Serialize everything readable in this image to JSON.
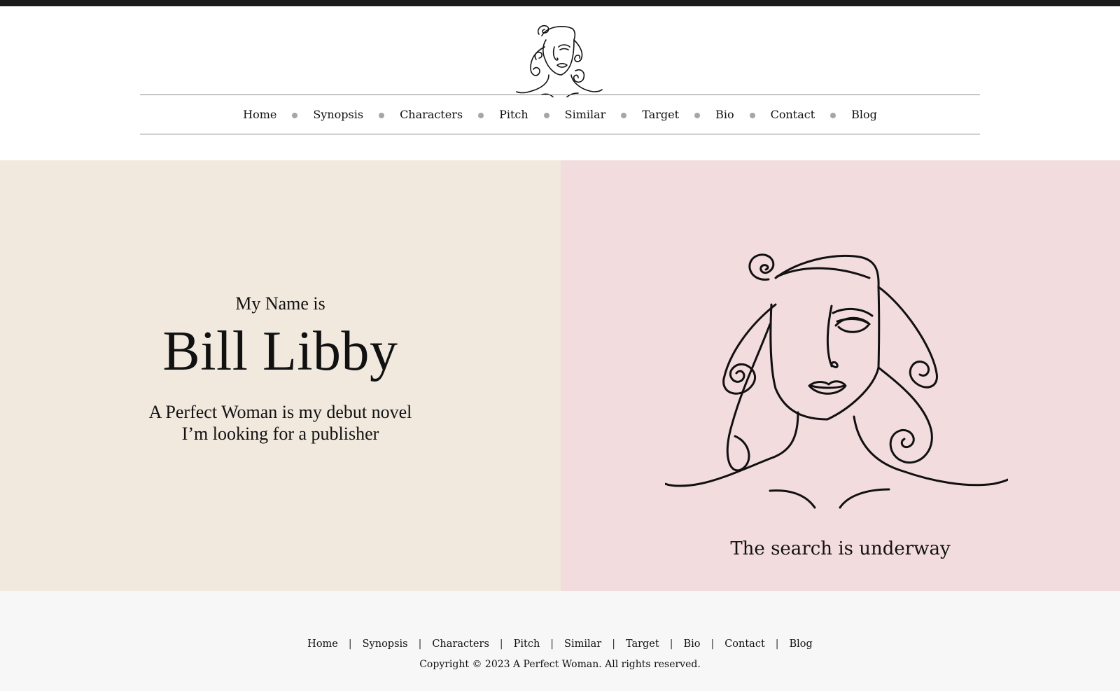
{
  "header": {
    "logo_icon": "line-art-woman-face-icon",
    "nav": [
      {
        "label": "Home"
      },
      {
        "label": "Synopsis"
      },
      {
        "label": "Characters"
      },
      {
        "label": "Pitch"
      },
      {
        "label": "Similar"
      },
      {
        "label": "Target"
      },
      {
        "label": "Bio"
      },
      {
        "label": "Contact"
      },
      {
        "label": "Blog"
      }
    ]
  },
  "hero": {
    "intro": "My Name is",
    "name": "Bill Libby",
    "line1": "A Perfect Woman is my debut novel",
    "line2": "I’m looking for a publisher",
    "portrait_icon": "line-art-woman-portrait",
    "caption": "The search is underway"
  },
  "footer": {
    "links": [
      {
        "label": "Home"
      },
      {
        "label": "Synopsis"
      },
      {
        "label": "Characters"
      },
      {
        "label": "Pitch"
      },
      {
        "label": "Similar"
      },
      {
        "label": "Target"
      },
      {
        "label": "Bio"
      },
      {
        "label": "Contact"
      },
      {
        "label": "Blog"
      }
    ],
    "separator": "|",
    "copyright": "Copyright © 2023 A Perfect Woman. All rights reserved."
  },
  "colors": {
    "top_bar": "#1b1b1b",
    "hero_left_bg": "#f1e9de",
    "hero_right_bg": "#f3dcde",
    "footer_bg": "#f7f7f7",
    "nav_dot": "#a6a6a6"
  }
}
